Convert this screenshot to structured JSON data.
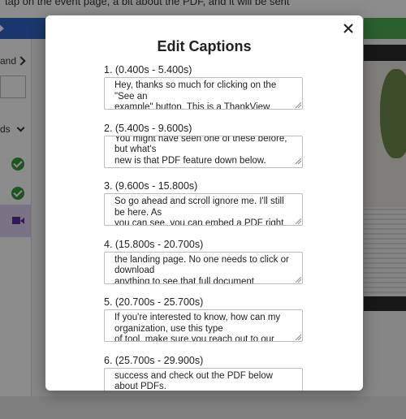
{
  "background": {
    "topbar_text": "tap on the event page, a bit about the PDF, and it will be sent",
    "sidebar_label": "and",
    "ds_label": "ds"
  },
  "modal": {
    "title": "Edit Captions",
    "close_icon": "close-icon",
    "captions": [
      {
        "label": "1. (0.400s - 5.400s)",
        "text": "Hey, thanks so much for clicking on the \"See an\nexample\" button. This is a ThankView"
      },
      {
        "label": "2. (5.400s - 9.600s)",
        "text": "You might have seen one of these before, but what's\nnew is that PDF feature down below."
      },
      {
        "label": "3. (9.600s - 15.800s)",
        "text": "So go ahead and scroll ignore me. I'll still be here. As\nyou can see, you can embed a PDF right"
      },
      {
        "label": "4. (15.800s - 20.700s)",
        "text": "the landing page. No one needs to click or download\nanything to see that full document"
      },
      {
        "label": "5. (20.700s - 25.700s)",
        "text": "If you're interested to know, how can my organization, use this type\nof tool, make sure you reach out to our"
      },
      {
        "label": "6. (25.700s - 29.900s)",
        "text": "success and check out the PDF below about PDFs."
      }
    ]
  },
  "colors": {
    "blue_bar": "#2e64c8",
    "green_bar": "#4caf50",
    "check_green": "#3a9a3a",
    "video_purple": "#5b2ea6"
  }
}
